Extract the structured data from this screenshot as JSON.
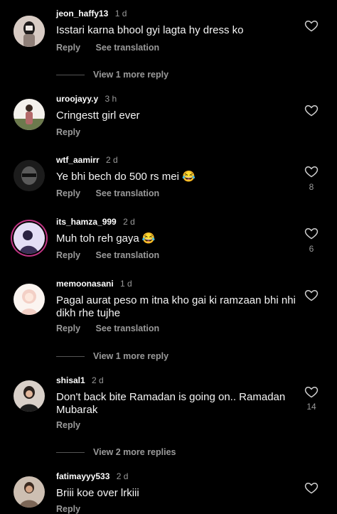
{
  "comments": [
    {
      "username": "jeon_haffy13",
      "time": "1 d",
      "text": "Isstari karna bhool gyi lagta hy dress ko",
      "reply": "Reply",
      "translate": "See translation",
      "likes": "",
      "view_more": "View 1 more reply",
      "avatar_color": "#c9b9b0"
    },
    {
      "username": "uroojayy.y",
      "time": "3 h",
      "text": "Cringestt girl ever",
      "reply": "Reply",
      "translate": "",
      "likes": "",
      "view_more": "",
      "avatar_color": "#6d7a54"
    },
    {
      "username": "wtf_aamirr",
      "time": "2 d",
      "text": "Ye bhi bech do 500 rs mei 😂",
      "reply": "Reply",
      "translate": "See translation",
      "likes": "8",
      "view_more": "",
      "avatar_color": "#2b2b2b"
    },
    {
      "username": "its_hamza_999",
      "time": "2 d",
      "text": "Muh toh reh gaya 😂",
      "reply": "Reply",
      "translate": "See translation",
      "likes": "6",
      "view_more": "",
      "avatar_color": "#d9d2ee"
    },
    {
      "username": "memoonasani",
      "time": "1 d",
      "text": "Pagal aurat peso m itna kho gai ki ramzaan bhi nhi dikh rhe tujhe",
      "reply": "Reply",
      "translate": "See translation",
      "likes": "",
      "view_more": "View 1 more reply",
      "avatar_color": "#f3e0d8"
    },
    {
      "username": "shisal1",
      "time": "2 d",
      "text": "Don't back bite Ramadan is going on.. Ramadan Mubarak",
      "reply": "Reply",
      "translate": "",
      "likes": "14",
      "view_more": "View 2 more replies",
      "avatar_color": "#3a3330"
    },
    {
      "username": "fatimayyy533",
      "time": "2 d",
      "text": "Briii koe over lrkiii",
      "reply": "Reply",
      "translate": "",
      "likes": "",
      "view_more": "",
      "avatar_color": "#b9a28e"
    }
  ]
}
